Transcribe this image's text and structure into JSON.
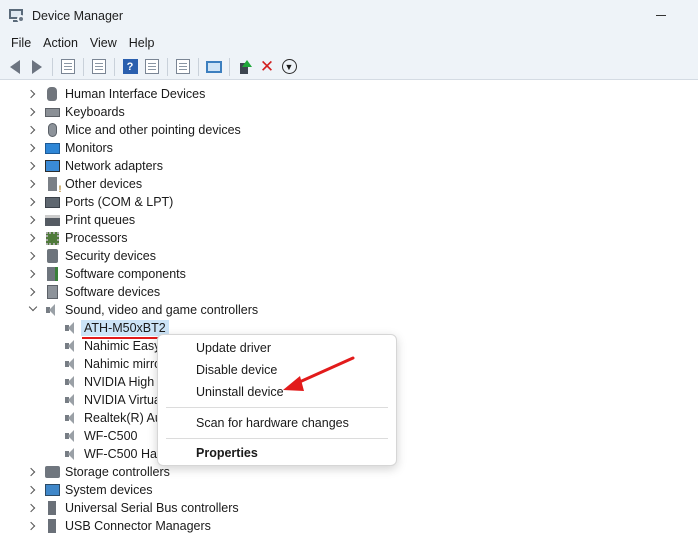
{
  "window": {
    "title": "Device Manager"
  },
  "menu": [
    "File",
    "Action",
    "View",
    "Help"
  ],
  "toolbar_icons": [
    "back-arrow-icon",
    "forward-arrow-icon",
    "properties-icon",
    "doc-icon",
    "help-icon",
    "view-icon",
    "scan-icon",
    "monitor-icon",
    "update-driver-icon",
    "uninstall-icon",
    "download-icon"
  ],
  "tree": {
    "categories_top": [
      {
        "label": "Human Interface Devices",
        "icon": "hid-icon"
      },
      {
        "label": "Keyboards",
        "icon": "keyboard-icon"
      },
      {
        "label": "Mice and other pointing devices",
        "icon": "mouse-icon"
      },
      {
        "label": "Monitors",
        "icon": "monitor-icon"
      },
      {
        "label": "Network adapters",
        "icon": "network-icon"
      },
      {
        "label": "Other devices",
        "icon": "other-device-icon"
      },
      {
        "label": "Ports (COM & LPT)",
        "icon": "port-icon"
      },
      {
        "label": "Print queues",
        "icon": "printer-icon"
      },
      {
        "label": "Processors",
        "icon": "processor-icon"
      },
      {
        "label": "Security devices",
        "icon": "security-icon"
      },
      {
        "label": "Software components",
        "icon": "software-component-icon"
      },
      {
        "label": "Software devices",
        "icon": "software-device-icon"
      }
    ],
    "expanded_category": {
      "label": "Sound, video and game controllers",
      "icon": "speaker-icon"
    },
    "children": [
      "ATH-M50xBT2",
      "Nahimic Easy",
      "Nahimic mirro",
      "NVIDIA High D",
      "NVIDIA Virtua",
      "Realtek(R) Au",
      "WF-C500",
      "WF-C500 Han"
    ],
    "categories_bottom": [
      {
        "label": "Storage controllers",
        "icon": "storage-icon"
      },
      {
        "label": "System devices",
        "icon": "system-icon"
      },
      {
        "label": "Universal Serial Bus controllers",
        "icon": "usb-icon"
      },
      {
        "label": "USB Connector Managers",
        "icon": "usb-icon"
      }
    ]
  },
  "context_menu": {
    "update": "Update driver",
    "disable": "Disable device",
    "uninstall": "Uninstall device",
    "scan": "Scan for hardware changes",
    "properties": "Properties"
  },
  "colors": {
    "annotation": "#e21b1b",
    "selection": "#cce4f7"
  }
}
